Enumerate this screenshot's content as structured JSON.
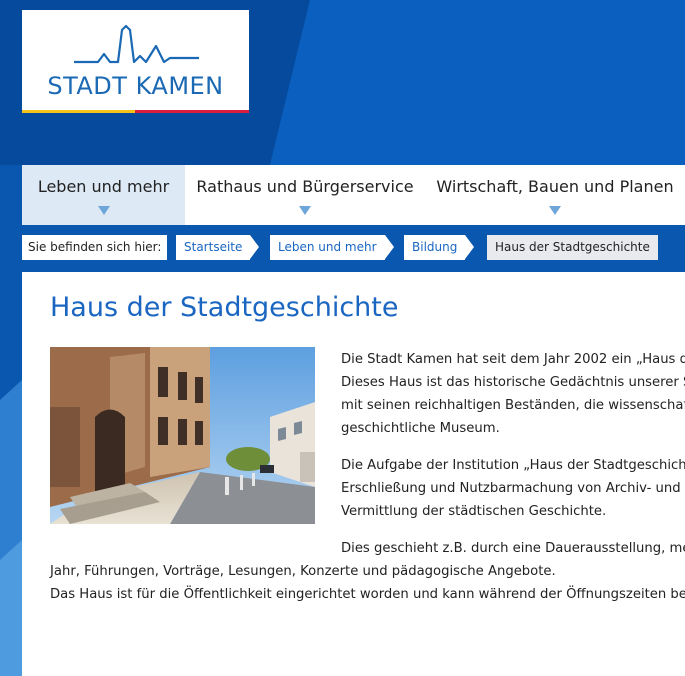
{
  "logo": {
    "text": "STADT KAMEN",
    "brand_color": "#1b69b4",
    "stripe_colors": [
      "#f2c318",
      "#d81f3f"
    ]
  },
  "nav": {
    "items": [
      {
        "label": "Leben und mehr",
        "active": true
      },
      {
        "label": "Rathaus und Bürgerservice",
        "active": false
      },
      {
        "label": "Wirtschaft, Bauen und Planen",
        "active": false
      }
    ]
  },
  "breadcrumb": {
    "label": "Sie befinden sich hier:",
    "items": [
      "Startseite",
      "Leben und mehr",
      "Bildung"
    ],
    "current": "Haus der Stadtgeschichte"
  },
  "page": {
    "title": "Haus der Stadtgeschichte",
    "image": "photo of historic building facade along a sunny street",
    "paragraphs": [
      {
        "lines": [
          "Die Stadt Kamen hat seit dem Jahr 2002 ein „Haus d",
          "Dieses Haus ist das historische Gedächtnis unserer S",
          "mit seinen reichhaltigen Beständen, die wissenschaf",
          "geschichtliche Museum."
        ]
      },
      {
        "lines": [
          "Die Aufgabe der Institution „Haus der Stadtgeschich",
          "Erschließung und Nutzbarmachung von Archiv- und",
          "Vermittlung der städtischen Geschichte."
        ]
      },
      {
        "lines": [
          "Dies geschieht z.B. durch eine Dauerausstellung, me",
          "Jahr, Führungen, Vorträge, Lesungen, Konzerte und pädagogische Angebote.",
          "Das Haus ist für die Öffentlichkeit eingerichtet worden und kann während der Öffnungszeiten be"
        ]
      }
    ]
  },
  "colors": {
    "background": "#0b58b3",
    "link": "#1a66c1",
    "nav_active": "#dde9f5"
  }
}
